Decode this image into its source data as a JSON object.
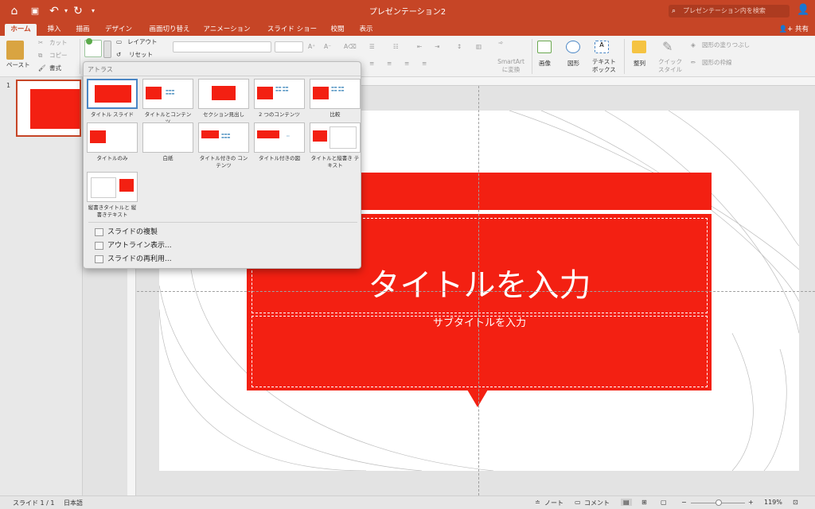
{
  "app": {
    "doc_title": "プレゼンテーション2",
    "search_placeholder": "プレゼンテーション内を検索"
  },
  "tabs": [
    "ホーム",
    "挿入",
    "描画",
    "デザイン",
    "画面切り替え",
    "アニメーション",
    "スライド ショー",
    "校閲",
    "表示"
  ],
  "share_label": "共有",
  "ribbon": {
    "paste": "ペースト",
    "cut": "カット",
    "copy": "コピー",
    "format": "書式",
    "layout": "レイアウト",
    "reset": "リセット",
    "smartart": "SmartArt に変換",
    "image": "画像",
    "shape": "図形",
    "textbox": "テキスト ボックス",
    "arrange": "整列",
    "quick_style": "クイック スタイル",
    "shape_fill": "図形の塗りつぶし",
    "shape_outline": "図形の枠線"
  },
  "layout_gallery": {
    "header": "アトラス",
    "layouts": [
      "タイトル スライド",
      "タイトルとコンテンツ",
      "セクション見出し",
      "2 つのコンテンツ",
      "比較",
      "タイトルのみ",
      "白紙",
      "タイトル付きの コンテンツ",
      "タイトル付きの図",
      "タイトルと縦書き テキスト",
      "縦書きタイトルと 縦書きテキスト"
    ],
    "menu": [
      "スライドの複製",
      "アウトライン表示...",
      "スライドの再利用..."
    ]
  },
  "thumbnail_number": "1",
  "slide": {
    "title": "タイトルを入力",
    "subtitle": "サブタイトルを入力"
  },
  "status": {
    "slide": "スライド 1 / 1",
    "language": "日本語",
    "notes": "ノート",
    "comments": "コメント",
    "zoom": "119%"
  },
  "colors": {
    "accent": "#c64526",
    "slide_red": "#f32012"
  }
}
